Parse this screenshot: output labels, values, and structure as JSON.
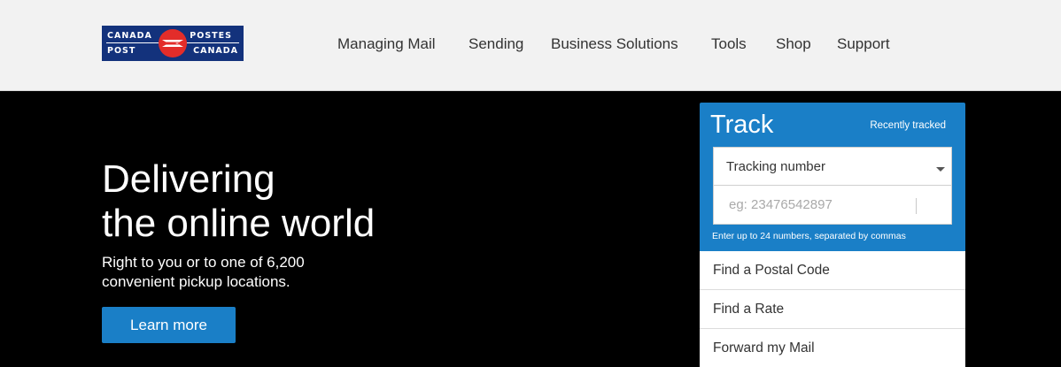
{
  "logo": {
    "top_left": "CANADA",
    "bottom_left": "POST",
    "top_right": "POSTES",
    "bottom_right": "CANADA",
    "colors": {
      "background": "#13327c",
      "emblem": "#e32d2a"
    }
  },
  "nav": {
    "items": [
      {
        "label": "Managing Mail"
      },
      {
        "label": "Sending"
      },
      {
        "label": "Business Solutions"
      },
      {
        "label": "Tools"
      },
      {
        "label": "Shop"
      },
      {
        "label": "Support"
      }
    ]
  },
  "hero": {
    "title_line1": "Delivering",
    "title_line2": "the online world",
    "subtitle": "Right to you or to one of 6,200 convenient pickup locations.",
    "button_label": "Learn more"
  },
  "track": {
    "title": "Track",
    "recent_link": "Recently tracked",
    "select_value": "Tracking number",
    "input_placeholder": "eg: 23476542897",
    "hint": "Enter up to 24 numbers, separated by commas"
  },
  "quick_links": [
    {
      "label": "Find a Postal Code"
    },
    {
      "label": "Find a Rate"
    },
    {
      "label": "Forward my Mail"
    }
  ],
  "colors": {
    "accent_blue": "#1a7fc7",
    "header_bg": "#f2f2f2",
    "hero_bg": "#000000"
  }
}
